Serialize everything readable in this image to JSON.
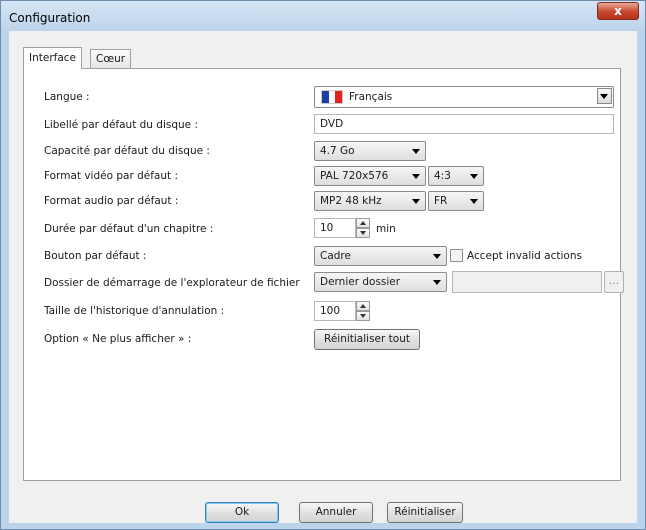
{
  "window": {
    "title": "Configuration",
    "close_glyph": "x"
  },
  "tabs": [
    {
      "label": "Interface"
    },
    {
      "label": "Cœur"
    }
  ],
  "form": {
    "language": {
      "label": "Langue :",
      "value": "Français",
      "flag_colors": [
        "#1a3fa0",
        "#ffffff",
        "#e0231e"
      ]
    },
    "disc_label": {
      "label": "Libellé par défaut du disque :",
      "value": "DVD"
    },
    "disc_capacity": {
      "label": "Capacité par défaut du disque :",
      "value": "4.7 Go"
    },
    "video_format": {
      "label": "Format vidéo par défaut :",
      "value": "PAL 720x576",
      "aspect": "4:3"
    },
    "audio_format": {
      "label": "Format audio par défaut :",
      "value": "MP2 48 kHz",
      "lang": "FR"
    },
    "chapter_duration": {
      "label": "Durée par défaut d'un chapitre :",
      "value": "10",
      "unit": "min"
    },
    "default_button": {
      "label": "Bouton par défaut :",
      "value": "Cadre",
      "checkbox_label": "Accept invalid actions"
    },
    "start_folder": {
      "label": "Dossier de démarrage de l'explorateur de fichier",
      "value": "Dernier dossier",
      "path": "",
      "browse": "..."
    },
    "undo_history": {
      "label": "Taille de l'historique d'annulation :",
      "value": "100"
    },
    "dont_show": {
      "label": "Option « Ne plus afficher » :",
      "button": "Réinitialiser tout"
    }
  },
  "footer": {
    "ok": "Ok",
    "cancel": "Annuler",
    "reset": "Réinitialiser"
  }
}
